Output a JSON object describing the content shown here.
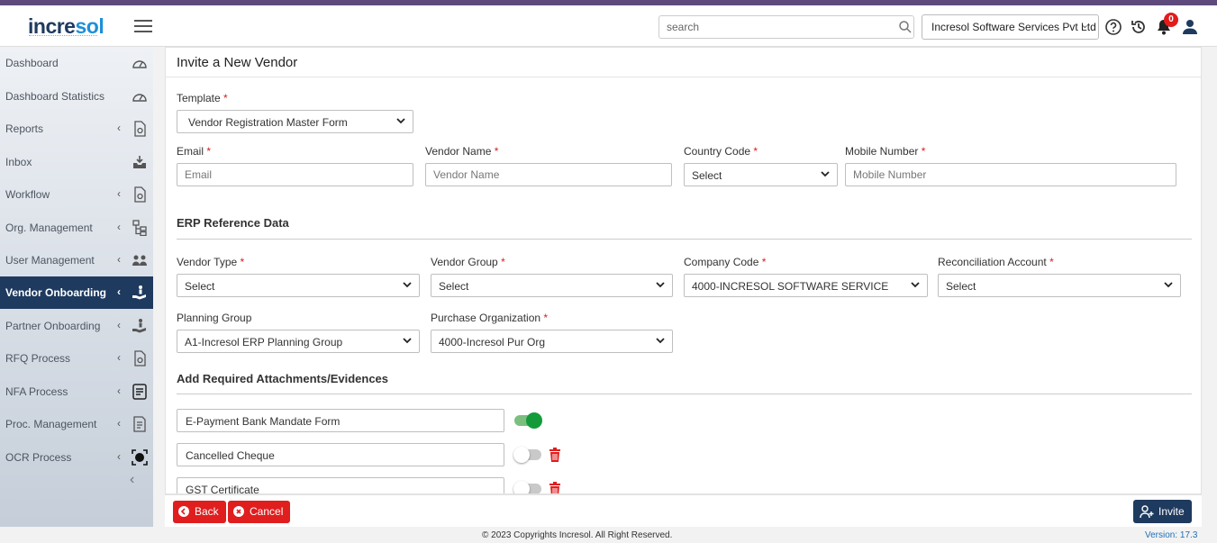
{
  "brand": {
    "logo_main": "incre",
    "logo_accent": "sol"
  },
  "search": {
    "placeholder": "search"
  },
  "header": {
    "company": "Incresol Software Services Pvt Ltd",
    "notification_count": "0"
  },
  "sidebar": {
    "items": [
      {
        "label": "Dashboard",
        "icon": "dashboard-gauge-icon",
        "arrow": ""
      },
      {
        "label": "Dashboard Statistics",
        "icon": "dashboard-gauge-icon",
        "arrow": ""
      },
      {
        "label": "Reports",
        "icon": "report-file-icon",
        "arrow": "‹"
      },
      {
        "label": "Inbox",
        "icon": "inbox-tray-icon",
        "arrow": ""
      },
      {
        "label": "Workflow",
        "icon": "workflow-file-icon",
        "arrow": "‹"
      },
      {
        "label": "Org. Management",
        "icon": "org-tree-icon",
        "arrow": "‹"
      },
      {
        "label": "User Management",
        "icon": "user-group-icon",
        "arrow": "‹"
      },
      {
        "label": "Vendor Onboarding",
        "icon": "vendor-hand-icon",
        "arrow": "‹"
      },
      {
        "label": "Partner Onboarding",
        "icon": "partner-hand-icon",
        "arrow": "‹"
      },
      {
        "label": "RFQ Process",
        "icon": "rfq-file-icon",
        "arrow": "‹"
      },
      {
        "label": "NFA Process",
        "icon": "nfa-list-icon",
        "arrow": "‹"
      },
      {
        "label": "Proc. Management",
        "icon": "procurement-doc-icon",
        "arrow": "‹"
      },
      {
        "label": "OCR Process",
        "icon": "ocr-scan-icon",
        "arrow": "‹"
      }
    ],
    "active_index": 7
  },
  "page": {
    "title": "Invite a New Vendor"
  },
  "form": {
    "template": {
      "label": "Template",
      "value": "Vendor Registration Master Form"
    },
    "email": {
      "label": "Email",
      "placeholder": "Email"
    },
    "vendor_name": {
      "label": "Vendor Name",
      "placeholder": "Vendor Name"
    },
    "country_code": {
      "label": "Country Code",
      "value": "Select"
    },
    "mobile": {
      "label": "Mobile Number",
      "placeholder": "Mobile Number"
    },
    "erp_section": "ERP Reference Data",
    "vendor_type": {
      "label": "Vendor Type",
      "value": "Select"
    },
    "vendor_group": {
      "label": "Vendor Group",
      "value": "Select"
    },
    "company_code": {
      "label": "Company Code",
      "value": "4000-INCRESOL SOFTWARE SERVICE"
    },
    "recon_account": {
      "label": "Reconciliation Account",
      "value": "Select"
    },
    "planning_group": {
      "label": "Planning Group",
      "value": "A1-Incresol ERP Planning Group"
    },
    "purchase_org": {
      "label": "Purchase Organization",
      "value": "4000-Incresol Pur Org"
    },
    "required_mark": "*",
    "attachments_section": "Add Required Attachments/Evidences",
    "attachments": [
      {
        "name": "E-Payment Bank Mandate Form",
        "enabled": true
      },
      {
        "name": "Cancelled Cheque",
        "enabled": false
      },
      {
        "name": "GST Certificate",
        "enabled": false
      }
    ]
  },
  "actions": {
    "back": "Back",
    "cancel": "Cancel",
    "invite": "Invite"
  },
  "footer": {
    "copyright": "© 2023 Copyrights Incresol. All Right Reserved.",
    "version": "Version: 17.3"
  },
  "colors": {
    "brand_navy": "#1f3a5f",
    "accent_blue": "#1f8fd8",
    "danger_red": "#e01e1e",
    "toggle_green": "#139b3a",
    "top_stripe": "#5e4a7d"
  }
}
